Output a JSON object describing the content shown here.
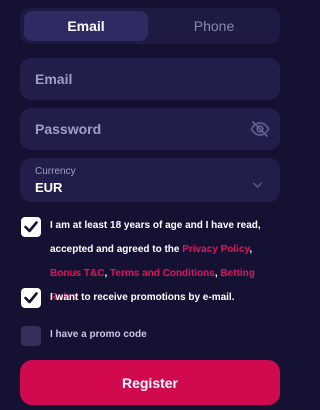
{
  "tabs": {
    "email": "Email",
    "phone": "Phone"
  },
  "fields": {
    "email_placeholder": "Email",
    "password_placeholder": "Password",
    "currency_label": "Currency",
    "currency_value": "EUR"
  },
  "terms": {
    "prefix": "I am at least 18 years of age and I have read, accepted and agreed to the ",
    "privacy": "Privacy Policy",
    "sep1": ", ",
    "bonus": "Bonus T&C",
    "sep2": ", ",
    "conditions": "Terms and Conditions",
    "sep3": ", ",
    "betting": "Betting Rules",
    "checked": true
  },
  "promotions": {
    "label": "I want to receive promotions by e-mail.",
    "checked": true
  },
  "promo_code": {
    "label": "I have a promo code",
    "checked": false
  },
  "register_label": "Register",
  "colors": {
    "background": "#141133",
    "field": "#211e4b",
    "accent": "#d1094e",
    "link": "#e0145b"
  },
  "icons": {
    "password_toggle": "eye-off-icon",
    "currency_toggle": "chevron-down-icon",
    "checkbox": "checkmark-icon"
  }
}
